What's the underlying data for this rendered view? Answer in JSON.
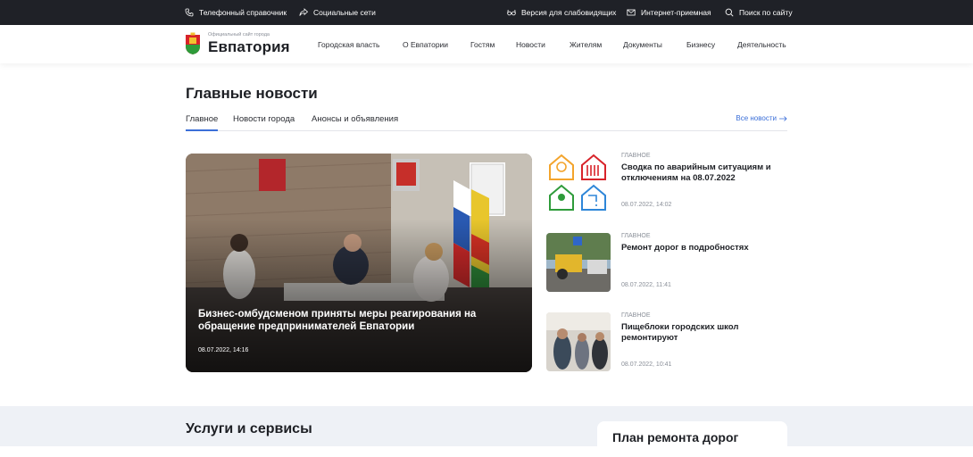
{
  "topbar": {
    "phone_book": "Телефонный справочник",
    "social": "Социальные сети",
    "low_vision": "Версия для слабовидящих",
    "reception": "Интернет-приемная",
    "search": "Поиск по сайту"
  },
  "header": {
    "logo_caption": "Официальный сайт города",
    "logo_title": "Евпатория",
    "nav": [
      "Городская власть",
      "О Евпатории",
      "Гостям",
      "Новости",
      "Жителям",
      "Документы",
      "Бизнесу",
      "Деятельность"
    ]
  },
  "news": {
    "title": "Главные новости",
    "tabs": [
      "Главное",
      "Новости города",
      "Анонсы и объявления"
    ],
    "all_news": "Все новости",
    "main": {
      "title": "Бизнес-омбудсменом приняты меры реагирования на обращение предпринимателей Евпатории",
      "date": "08.07.2022, 14:16"
    },
    "items": [
      {
        "category": "ГЛАВНОЕ",
        "title": "Сводка по аварийным ситуациям и отключениям на 08.07.2022",
        "date": "08.07.2022, 14:02",
        "thumb": "utility-icons"
      },
      {
        "category": "ГЛАВНОЕ",
        "title": "Ремонт дорог в подробностях",
        "date": "08.07.2022, 11:41",
        "thumb": "road-repair-photo"
      },
      {
        "category": "ГЛАВНОЕ",
        "title": "Пищеблоки городских школ ремонтируют",
        "date": "08.07.2022, 10:41",
        "thumb": "school-kitchen-photo"
      }
    ]
  },
  "services": {
    "title": "Услуги и сервисы",
    "plan_title": "План ремонта дорог"
  },
  "colors": {
    "topbar_bg": "#1f2127",
    "accent": "#3b6fd8",
    "band_bg": "#eef1f6"
  }
}
